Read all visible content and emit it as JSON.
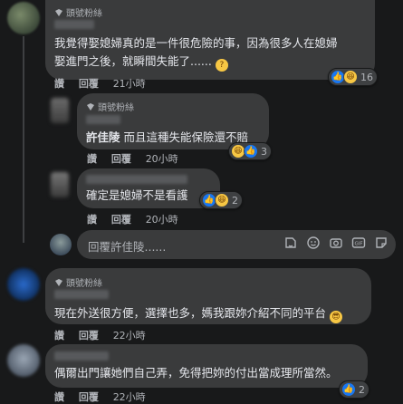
{
  "badge_label": "頭號粉絲",
  "comments": [
    {
      "text_line1": "我覺得娶媳婦真的是一件很危險的事，因為很多人在媳婦",
      "text_line2": "娶進門之後，就瞬間失能了......",
      "like": "讚",
      "reply": "回覆",
      "time": "21小時",
      "reaction_count": "16"
    },
    {
      "mention": "許佳陵",
      "text": "而且這種失能保險還不賠",
      "like": "讚",
      "reply": "回覆",
      "time": "20小時",
      "reaction_count": "3"
    },
    {
      "text": "確定是媳婦不是看護",
      "like": "讚",
      "reply": "回覆",
      "time": "20小時",
      "reaction_count": "2"
    },
    {
      "text": "現在外送很方便，選擇也多，媽我跟妳介紹不同的平台",
      "like": "讚",
      "reply": "回覆",
      "time": "22小時"
    },
    {
      "text": "偶爾出門讓她們自己弄，免得把妳的付出當成理所當然。",
      "like": "讚",
      "reply": "回覆",
      "time": "22小時",
      "reaction_count": "2"
    }
  ],
  "reply_input": {
    "placeholder": "回覆許佳陵......"
  },
  "icons": [
    "fan-badge-icon",
    "sticker-icon",
    "emoji-icon",
    "camera-icon",
    "gif-icon",
    "sticker-face-icon",
    "like-reaction-icon",
    "haha-reaction-icon"
  ],
  "colors": {
    "background": "#18191a",
    "bubble": "#3a3b3c",
    "text": "#e4e6eb",
    "muted": "#b0b3b8",
    "like_blue": "#1877f2",
    "haha_yellow": "#f7c744"
  }
}
